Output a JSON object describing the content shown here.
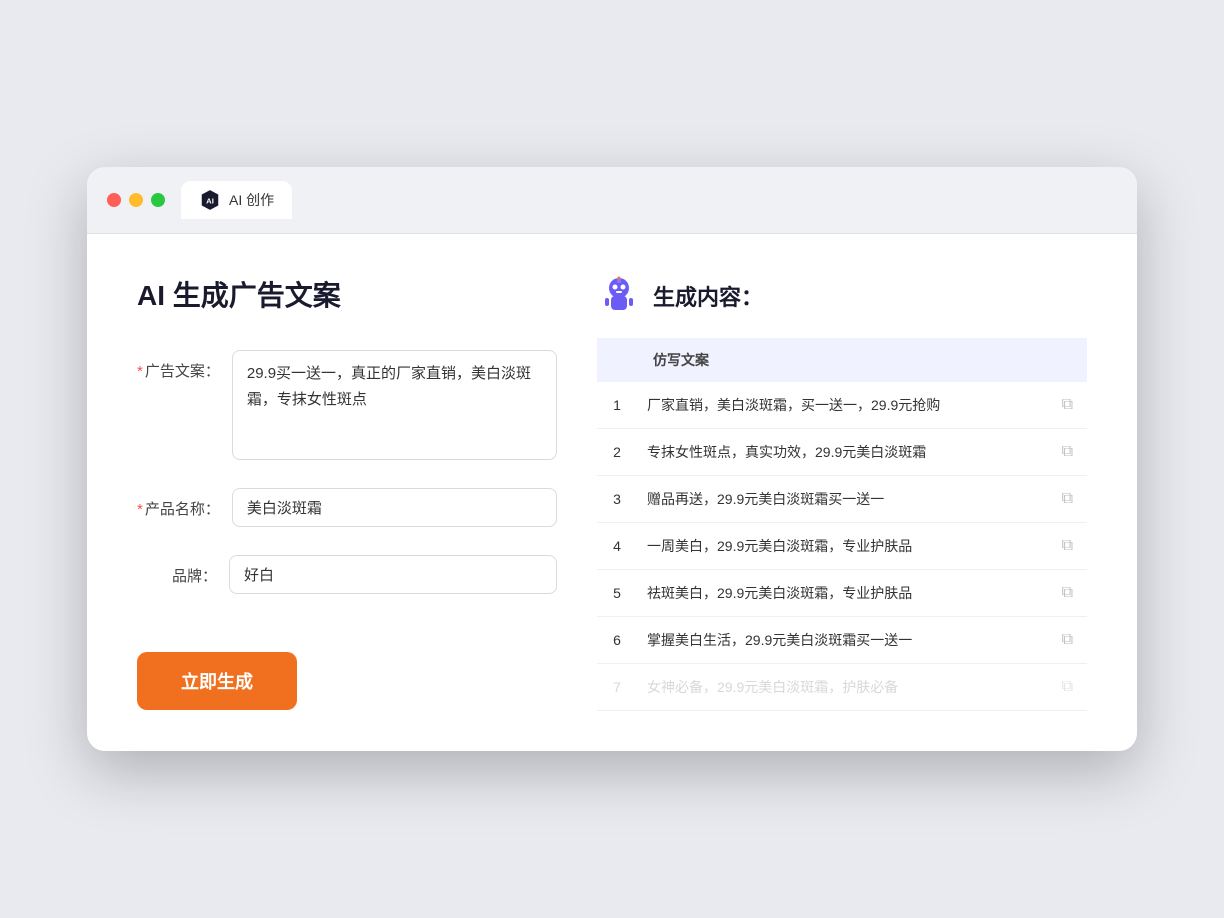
{
  "browser": {
    "tab_label": "AI 创作"
  },
  "page": {
    "title": "AI 生成广告文案",
    "form": {
      "ad_copy_label": "广告文案：",
      "ad_copy_required": "*",
      "ad_copy_value": "29.9买一送一，真正的厂家直销，美白淡斑霜，专抹女性斑点",
      "product_name_label": "产品名称：",
      "product_name_required": "*",
      "product_name_value": "美白淡斑霜",
      "brand_label": "品牌：",
      "brand_value": "好白",
      "generate_btn": "立即生成"
    },
    "result": {
      "title": "生成内容：",
      "table_header": "仿写文案",
      "items": [
        {
          "id": 1,
          "text": "厂家直销，美白淡斑霜，买一送一，29.9元抢购"
        },
        {
          "id": 2,
          "text": "专抹女性斑点，真实功效，29.9元美白淡斑霜"
        },
        {
          "id": 3,
          "text": "赠品再送，29.9元美白淡斑霜买一送一"
        },
        {
          "id": 4,
          "text": "一周美白，29.9元美白淡斑霜，专业护肤品"
        },
        {
          "id": 5,
          "text": "祛斑美白，29.9元美白淡斑霜，专业护肤品"
        },
        {
          "id": 6,
          "text": "掌握美白生活，29.9元美白淡斑霜买一送一"
        },
        {
          "id": 7,
          "text": "女神必备，29.9元美白淡斑霜，护肤必备",
          "dim": true
        }
      ]
    }
  }
}
